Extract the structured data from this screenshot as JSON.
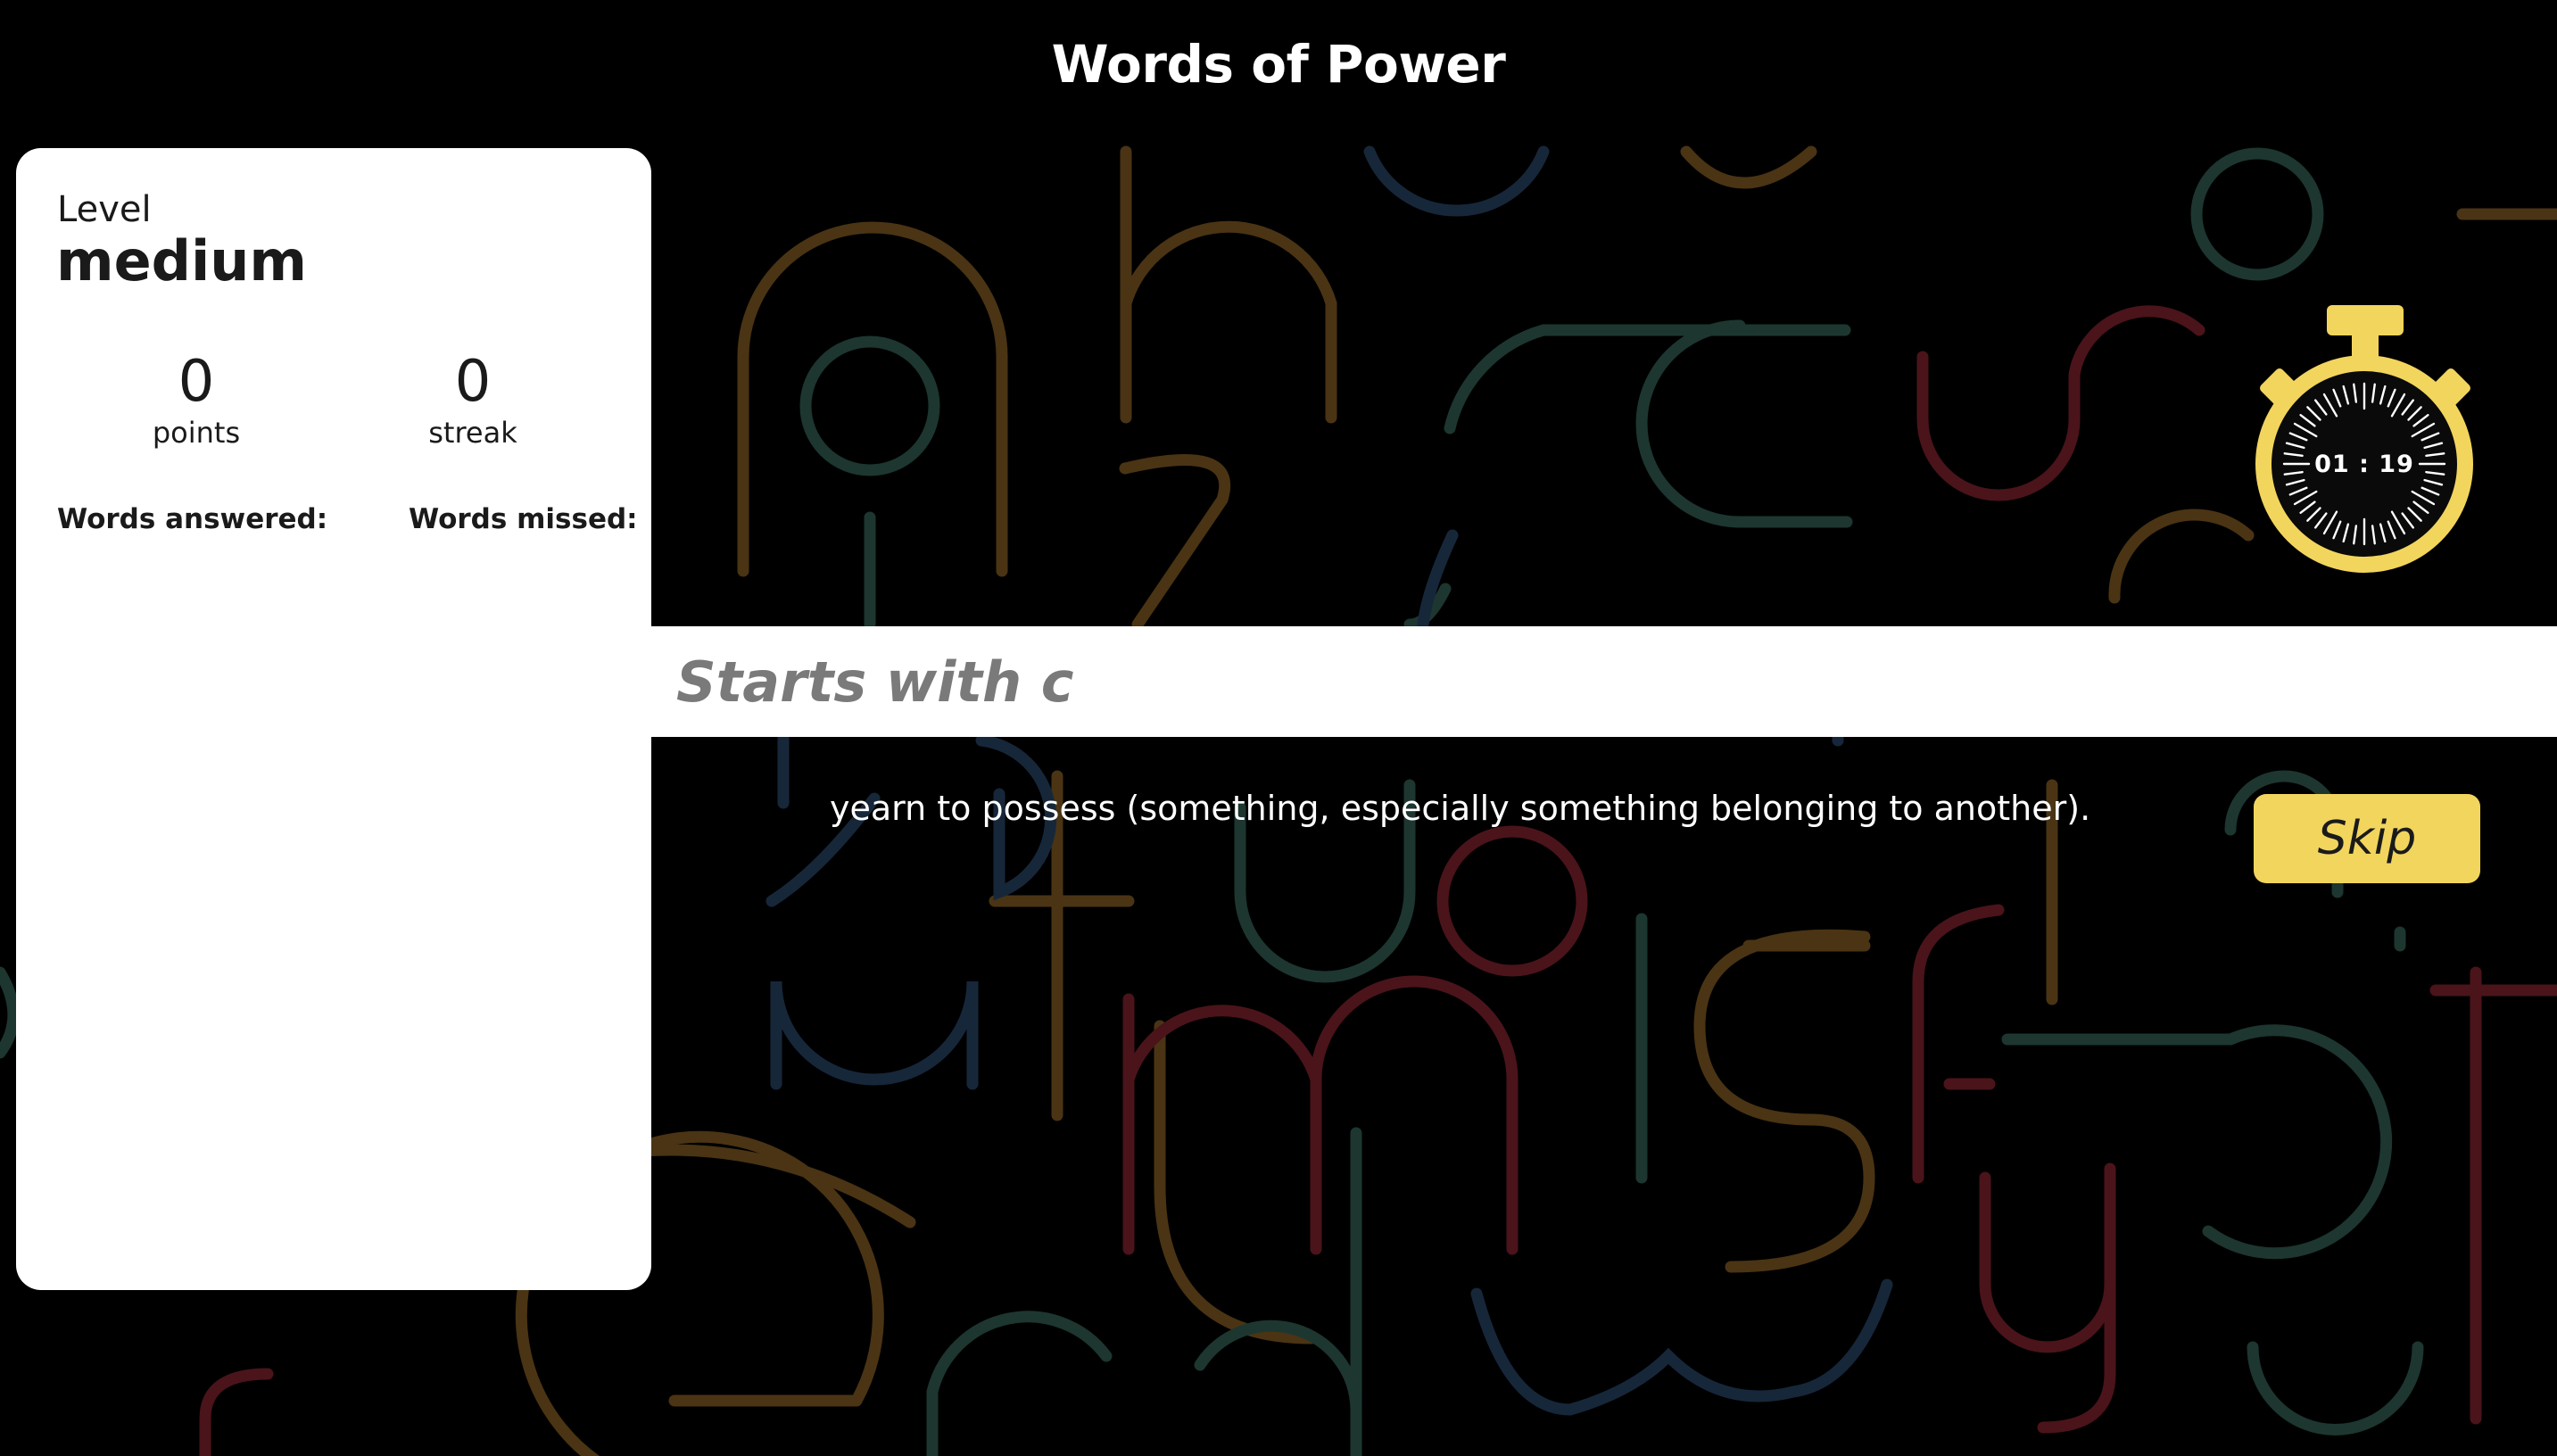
{
  "app": {
    "title": "Words of Power"
  },
  "scorecard": {
    "level_label": "Level",
    "level_value": "medium",
    "points_value": "0",
    "points_label": "points",
    "streak_value": "0",
    "streak_label": "streak",
    "answered_heading": "Words answered:",
    "missed_heading": "Words missed:",
    "answered_words": [],
    "missed_words": []
  },
  "timer": {
    "display": "01 : 19",
    "icon": "stopwatch-icon"
  },
  "game": {
    "input_value": "",
    "input_placeholder": "Starts with c",
    "clue": "yearn to possess (something, especially something belonging to another).",
    "skip_label": "Skip"
  },
  "colors": {
    "background": "#000000",
    "card": "#ffffff",
    "accent_yellow": "#f2d55d",
    "letter_brown": "#4a3414",
    "letter_green": "#1d3630",
    "letter_red": "#4a141a",
    "letter_blue": "#17273a"
  }
}
